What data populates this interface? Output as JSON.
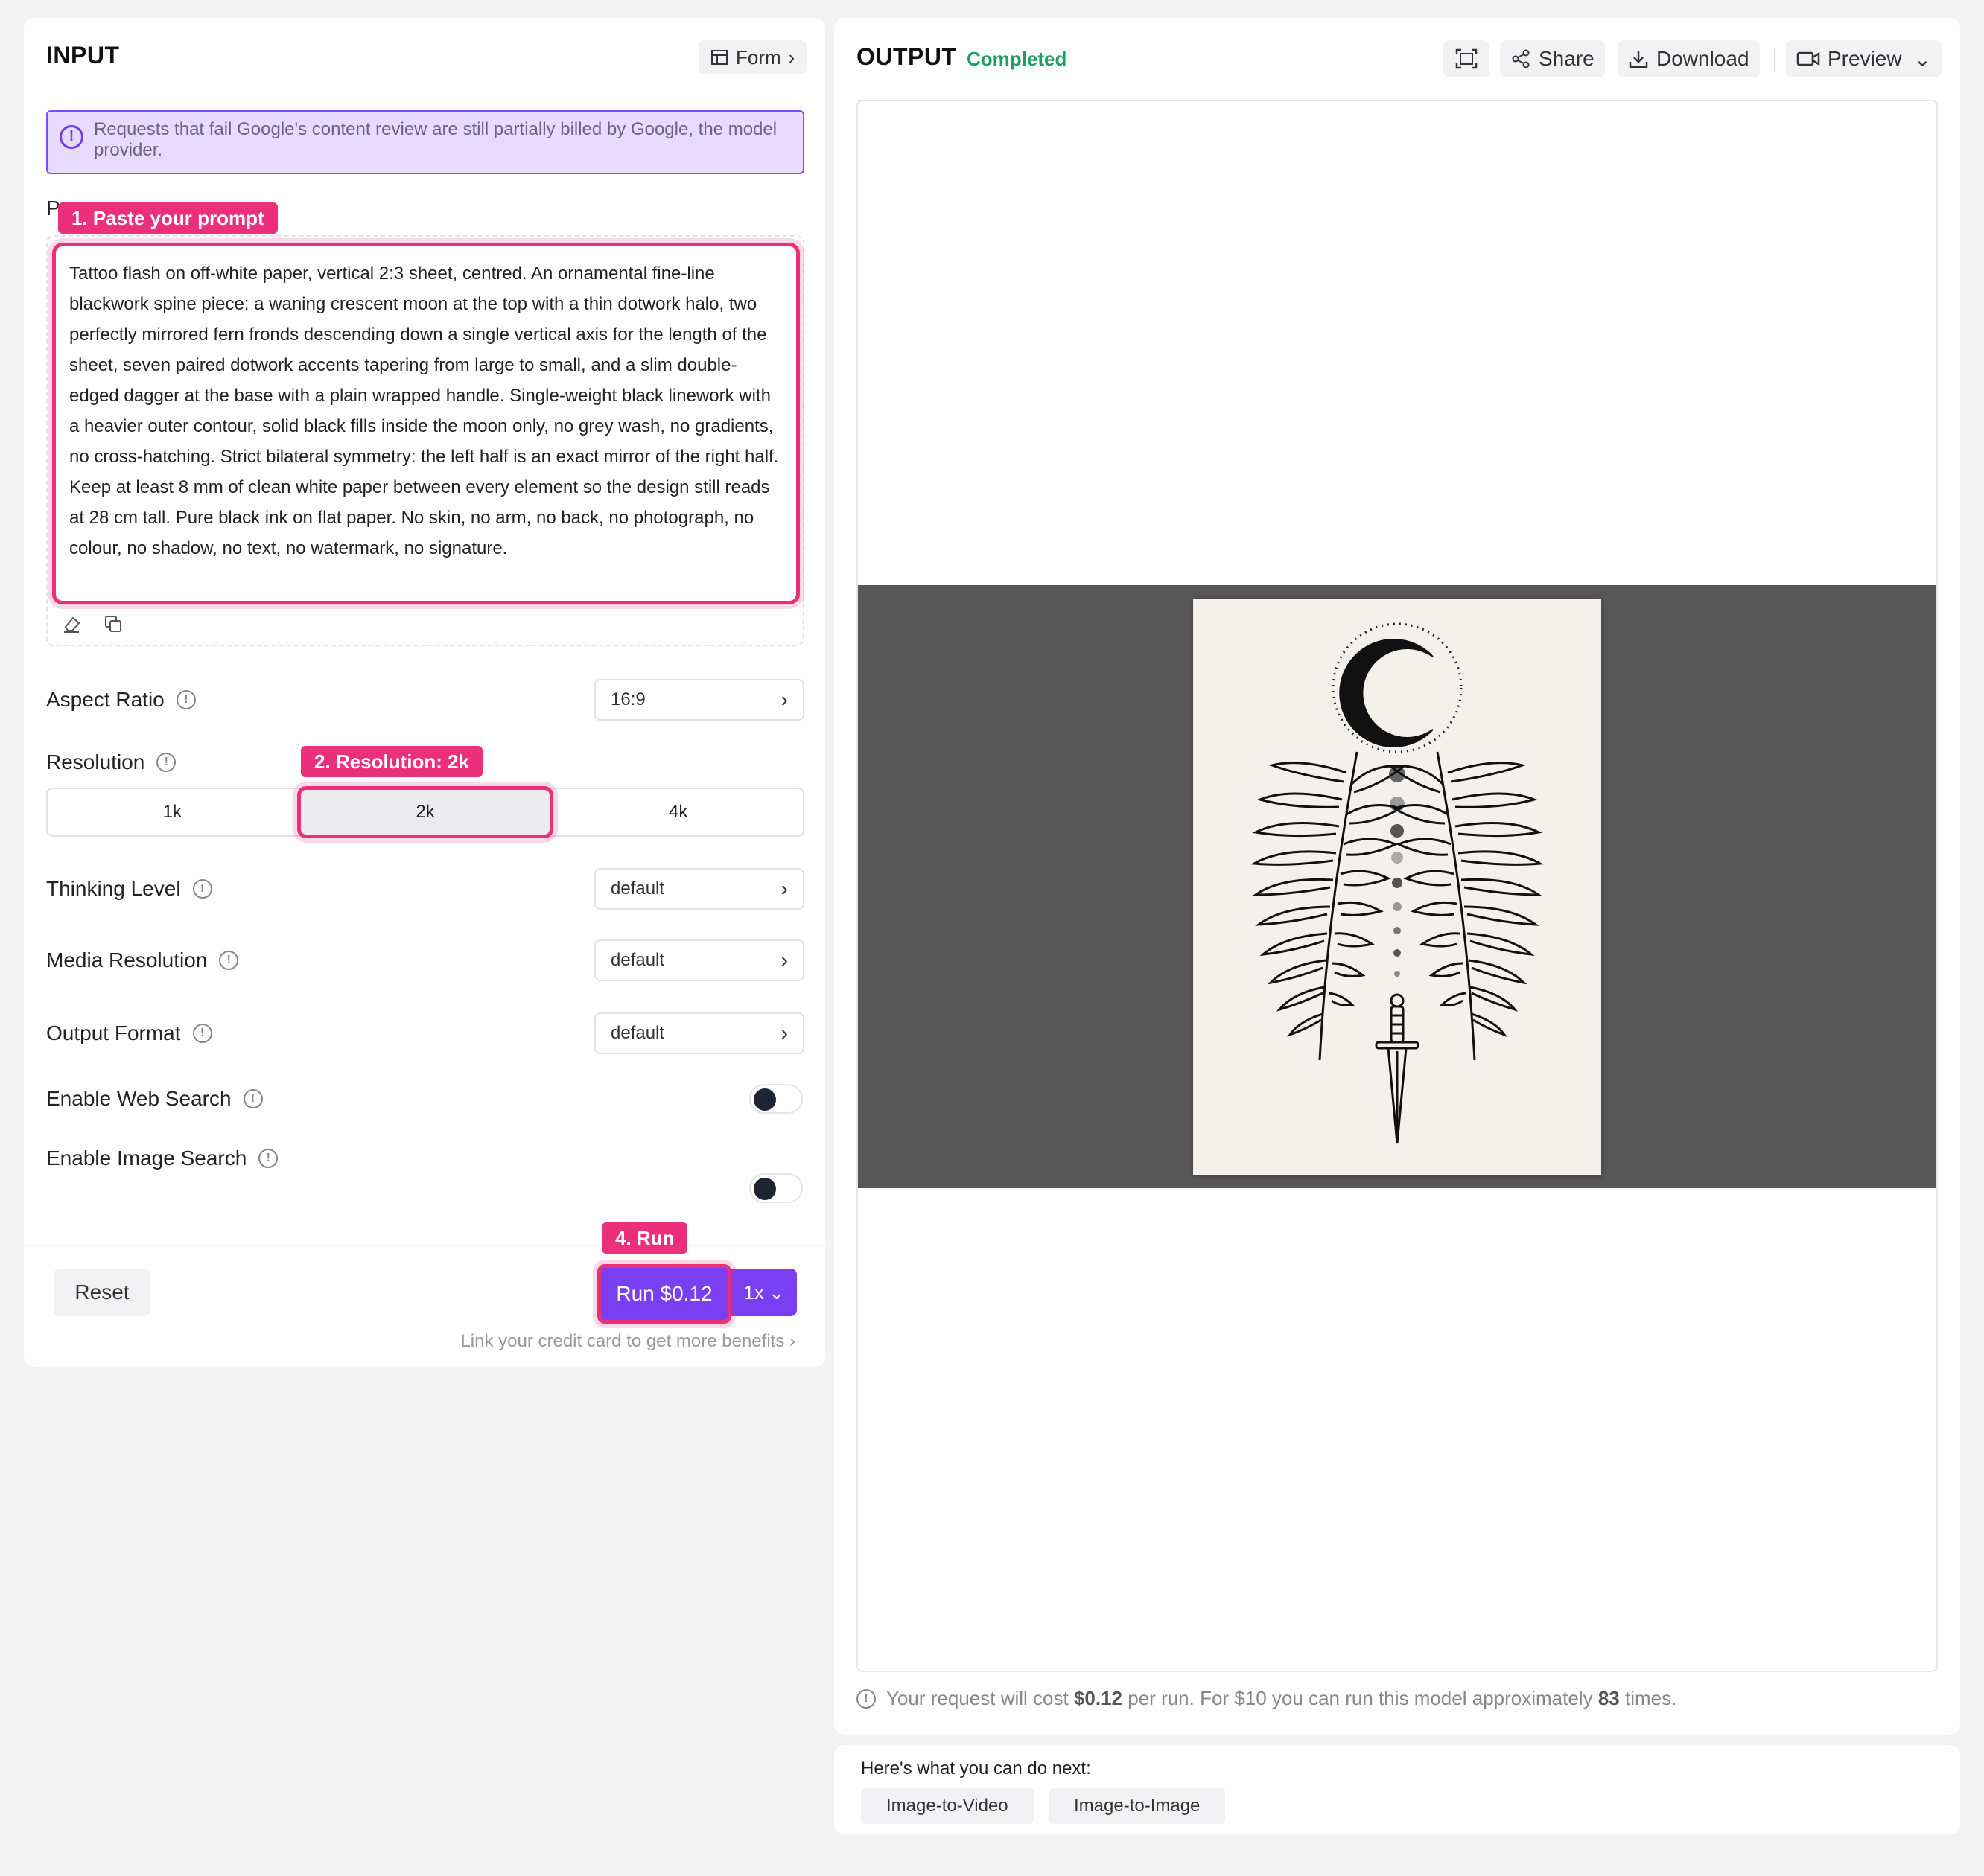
{
  "input": {
    "title": "INPUT",
    "form_button": "Form",
    "notice": "Requests that fail Google's content review are still partially billed by Google, the model provider.",
    "prompt_label_partial": "P",
    "prompt_text": "Tattoo flash on off-white paper, vertical 2:3 sheet, centred. An ornamental fine-line blackwork spine piece: a waning crescent moon at the top with a thin dotwork halo, two perfectly mirrored fern fronds descending down a single vertical axis for the length of the sheet, seven paired dotwork accents tapering from large to small, and a slim double-edged dagger at the base with a plain wrapped handle. Single-weight black linework with a heavier outer contour, solid black fills inside the moon only, no grey wash, no gradients, no cross-hatching. Strict bilateral symmetry: the left half is an exact mirror of the right half. Keep at least 8 mm of clean white paper between every element so the design still reads at 28 cm tall. Pure black ink on flat paper. No skin, no arm, no back, no photograph, no colour, no shadow, no text, no watermark, no signature.",
    "fields": {
      "aspect_ratio": {
        "label": "Aspect Ratio",
        "value": "16:9"
      },
      "resolution": {
        "label": "Resolution",
        "options": [
          "1k",
          "2k",
          "4k"
        ],
        "selected": "2k"
      },
      "thinking_level": {
        "label": "Thinking Level",
        "value": "default"
      },
      "media_resolution": {
        "label": "Media Resolution",
        "value": "default"
      },
      "output_format": {
        "label": "Output Format",
        "value": "default"
      },
      "web_search": {
        "label": "Enable Web Search",
        "enabled": false
      },
      "image_search": {
        "label": "Enable Image Search",
        "enabled": false
      }
    },
    "reset_label": "Reset",
    "run_label": "Run $0.12",
    "multiplier": "1x",
    "credit_link": "Link your credit card to get more benefits"
  },
  "annotations": {
    "step1": "1. Paste your prompt",
    "step2": "2. Resolution: 2k",
    "step4": "4. Run"
  },
  "output": {
    "title": "OUTPUT",
    "status": "Completed",
    "share_label": "Share",
    "download_label": "Download",
    "preview_label": "Preview",
    "cost_prefix": "Your request will cost",
    "cost_amount": "$0.12",
    "cost_middle": "per run. For $10 you can run this model approximately",
    "cost_runs": "83",
    "cost_suffix": "times."
  },
  "next": {
    "title": "Here's what you can do next:",
    "actions": [
      "Image-to-Video",
      "Image-to-Image"
    ]
  },
  "colors": {
    "accent": "#7a3ff2",
    "highlight": "#ec2f7b",
    "status_green": "#1f9d63",
    "notice_bg": "#e7dcff"
  }
}
